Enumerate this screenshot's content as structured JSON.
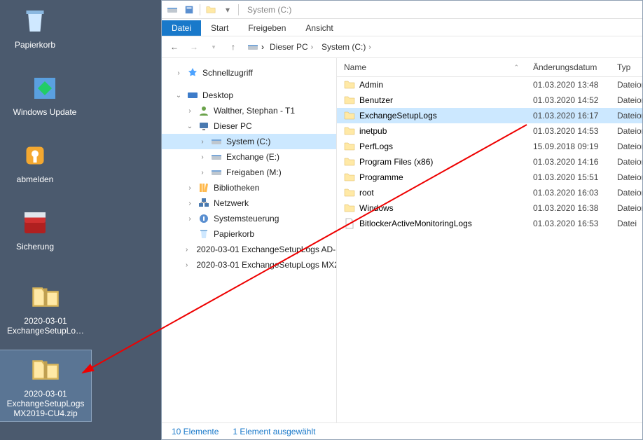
{
  "desktop_icons": [
    {
      "id": "papierkorb",
      "label": "Papierkorb",
      "icon": "recycle-bin-icon"
    },
    {
      "id": "windows-update",
      "label": "Windows Update",
      "icon": "update-icon"
    },
    {
      "id": "abmelden",
      "label": "abmelden",
      "icon": "key-icon"
    },
    {
      "id": "sicherung",
      "label": "Sicherung",
      "icon": "toolbox-icon"
    },
    {
      "id": "zip1",
      "label": "2020-03-01 ExchangeSetupLo…",
      "icon": "zip-icon"
    },
    {
      "id": "zip2",
      "label": "2020-03-01 ExchangeSetupLogs MX2019-CU4.zip",
      "icon": "zip-icon",
      "selected": true
    }
  ],
  "qat": {
    "title": "System (C:)"
  },
  "tabs": {
    "datei": "Datei",
    "start": "Start",
    "freigeben": "Freigeben",
    "ansicht": "Ansicht"
  },
  "breadcrumb": {
    "pc": "Dieser PC",
    "drive": "System (C:)"
  },
  "nav": {
    "schnellzugriff": "Schnellzugriff",
    "desktop": "Desktop",
    "user": "Walther, Stephan - T1",
    "dieser_pc": "Dieser PC",
    "system_c": "System (C:)",
    "exchange_e": "Exchange (E:)",
    "freigaben_m": "Freigaben (M:)",
    "bibliotheken": "Bibliotheken",
    "netzwerk": "Netzwerk",
    "systemsteuerung": "Systemsteuerung",
    "papierkorb": "Papierkorb",
    "zip_ad": "2020-03-01 ExchangeSetupLogs AD-",
    "zip_mx": "2020-03-01 ExchangeSetupLogs MX2"
  },
  "columns": {
    "name": "Name",
    "date": "Änderungsdatum",
    "type": "Typ"
  },
  "files": [
    {
      "name": "Admin",
      "date": "01.03.2020 13:48",
      "type": "Dateior",
      "icon": "folder"
    },
    {
      "name": "Benutzer",
      "date": "01.03.2020 14:52",
      "type": "Dateior",
      "icon": "folder"
    },
    {
      "name": "ExchangeSetupLogs",
      "date": "01.03.2020 16:17",
      "type": "Dateior",
      "icon": "folder",
      "selected": true
    },
    {
      "name": "inetpub",
      "date": "01.03.2020 14:53",
      "type": "Dateior",
      "icon": "folder"
    },
    {
      "name": "PerfLogs",
      "date": "15.09.2018 09:19",
      "type": "Dateior",
      "icon": "folder"
    },
    {
      "name": "Program Files (x86)",
      "date": "01.03.2020 14:16",
      "type": "Dateior",
      "icon": "folder"
    },
    {
      "name": "Programme",
      "date": "01.03.2020 15:51",
      "type": "Dateior",
      "icon": "folder"
    },
    {
      "name": "root",
      "date": "01.03.2020 16:03",
      "type": "Dateior",
      "icon": "folder"
    },
    {
      "name": "Windows",
      "date": "01.03.2020 16:38",
      "type": "Dateior",
      "icon": "folder"
    },
    {
      "name": "BitlockerActiveMonitoringLogs",
      "date": "01.03.2020 16:53",
      "type": "Datei",
      "icon": "file"
    }
  ],
  "status": {
    "count": "10 Elemente",
    "selected": "1 Element ausgewählt"
  }
}
